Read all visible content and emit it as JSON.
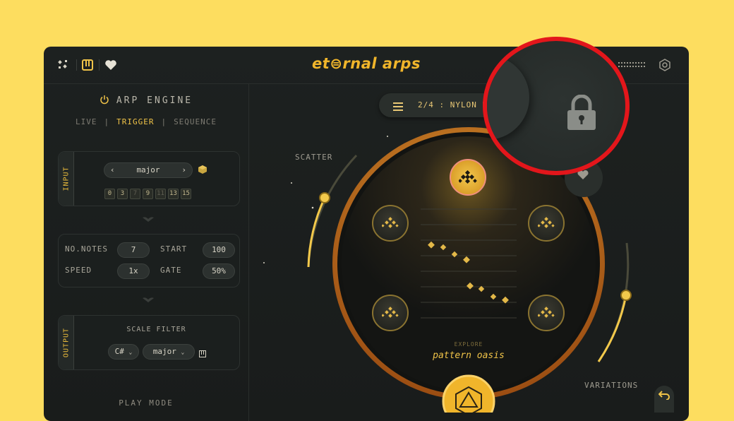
{
  "app": {
    "logo_text": "et⊜rnal arps"
  },
  "topbar": {
    "left_icons": [
      "dice-icon",
      "piano-icon",
      "heart-icon"
    ],
    "right_icons": [
      "keyboard-icon",
      "settings-icon"
    ]
  },
  "engine": {
    "title": "ARP ENGINE",
    "modes": [
      "LIVE",
      "TRIGGER",
      "SEQUENCE"
    ],
    "active_mode": "TRIGGER"
  },
  "input_card": {
    "tab_label": "INPUT",
    "scale": "major",
    "notes": [
      "0",
      "3",
      "7",
      "9",
      "11",
      "13",
      "15"
    ]
  },
  "params": {
    "no_notes_label": "NO.NOTES",
    "no_notes_value": "7",
    "start_label": "START",
    "start_value": "100",
    "speed_label": "SPEED",
    "speed_value": "1x",
    "gate_label": "GATE",
    "gate_value": "50%"
  },
  "output_card": {
    "tab_label": "OUTPUT",
    "title": "SCALE FILTER",
    "key": "C#",
    "scale": "major"
  },
  "play_mode_label": "PLAY MODE",
  "preset": {
    "label": "2/4 : NYLON NO"
  },
  "scatter_label": "SCATTER",
  "variations_label": "VARIATIONS",
  "pattern": {
    "explore_label": "EXPLORE",
    "name": "pattern oasis"
  },
  "colors": {
    "accent": "#f0c348",
    "bg": "#fddd5f",
    "panel": "#1d2120",
    "highlight_ring": "#e3161b"
  }
}
